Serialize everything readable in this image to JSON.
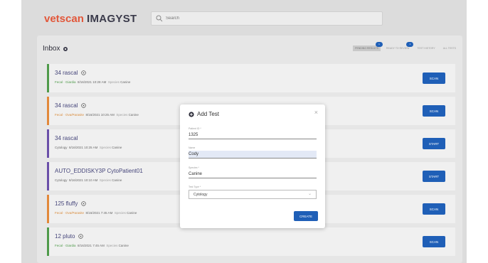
{
  "brand": {
    "part1": "vetscan",
    "part2": "IMAGYST"
  },
  "search": {
    "placeholder": "Search"
  },
  "inbox": {
    "title": "Inbox",
    "filters": [
      {
        "label": "PENDING RESULTS",
        "badge": "1"
      },
      {
        "label": "READY TO REVIEW",
        "badge": "1"
      },
      {
        "label": "TEST HISTORY",
        "badge": ""
      },
      {
        "label": "ALL TESTS",
        "badge": ""
      }
    ]
  },
  "rows": [
    {
      "name": "34 rascal",
      "tag": "Fecal · Giardia",
      "time": "8/16/2021 10:28 AM",
      "species_label": "Species",
      "species": "Canine",
      "action": "SCAN"
    },
    {
      "name": "34 rascal",
      "tag": "Fecal · Ova/Parasite",
      "time": "8/16/2021 10:25 AM",
      "species_label": "Species",
      "species": "Canine",
      "action": "SCAN"
    },
    {
      "name": "34 rascal",
      "tag": "Cytology",
      "time": "8/16/2021 10:25 AM",
      "species_label": "Species",
      "species": "Canine",
      "action": "START"
    },
    {
      "name": "AUTO_EDDISKY3P CytoPatient01",
      "tag": "Cytology",
      "time": "8/16/2021 10:10 AM",
      "species_label": "Species",
      "species": "Canine",
      "action": "START"
    },
    {
      "name": "125 fluffy",
      "tag": "Fecal · Ova/Parasite",
      "time": "8/16/2021 7:45 AM",
      "species_label": "Species",
      "species": "Canine",
      "action": "SCAN"
    },
    {
      "name": "12 pluto",
      "tag": "Fecal · Giardia",
      "time": "8/16/2021 7:45 AM",
      "species_label": "Species",
      "species": "Canine",
      "action": "SCAN"
    }
  ],
  "modal": {
    "title": "Add Test",
    "patient_id_label": "Patient ID *",
    "patient_id": "1325",
    "name_label": "Name",
    "name": "Cody",
    "species_label": "Species *",
    "species": "Canine",
    "test_type_label": "Test Type *",
    "test_type": "Cytology",
    "create": "CREATE"
  }
}
